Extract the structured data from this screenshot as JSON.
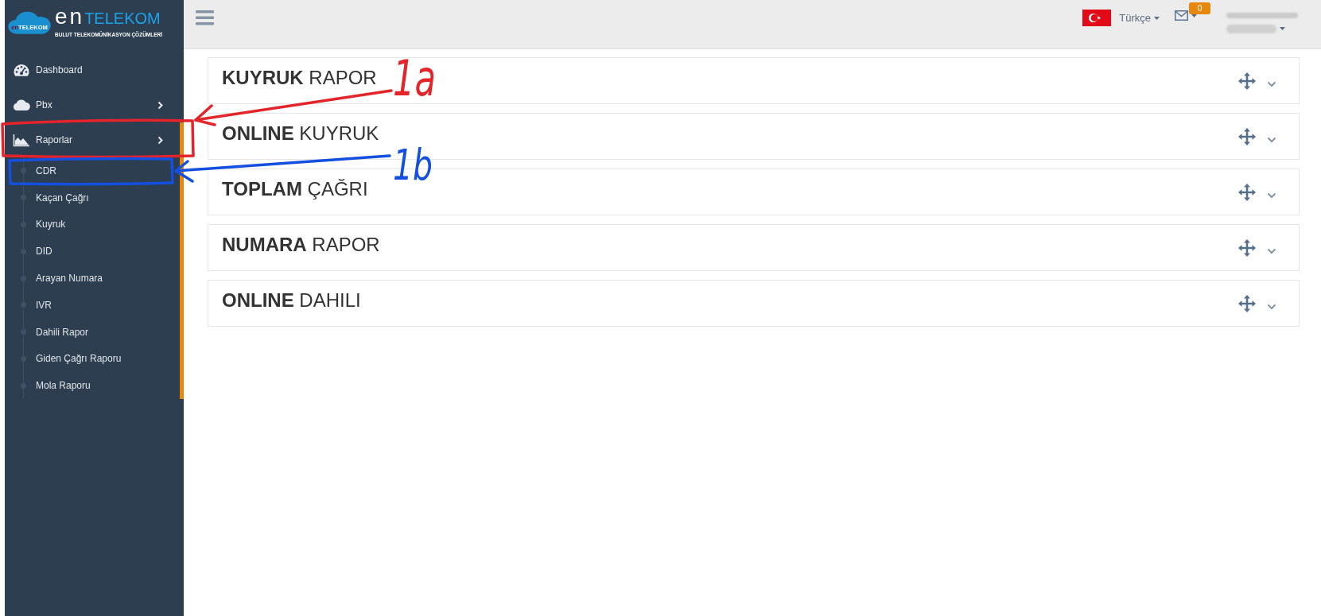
{
  "logo": {
    "badge": [
      "en",
      "TELEKOM"
    ],
    "wordmark": [
      "en",
      "TELEKOM"
    ],
    "tagline": "BULUT TELEKOMÜNİKASYON ÇÖZÜMLERİ"
  },
  "sidebar": {
    "items": [
      {
        "label": "Dashboard",
        "kind": "link"
      },
      {
        "label": "Pbx",
        "kind": "group",
        "expanded": false
      },
      {
        "label": "Raporlar",
        "kind": "group",
        "expanded": true,
        "children": [
          {
            "label": "CDR"
          },
          {
            "label": "Kaçan Çağrı"
          },
          {
            "label": "Kuyruk"
          },
          {
            "label": "DID"
          },
          {
            "label": "Arayan Numara"
          },
          {
            "label": "IVR"
          },
          {
            "label": "Dahili Rapor"
          },
          {
            "label": "Giden Çağrı Raporu"
          },
          {
            "label": "Mola Raporu"
          }
        ]
      }
    ]
  },
  "topbar": {
    "language": "Türkçe",
    "message_count": "0"
  },
  "panels": [
    {
      "title": "**KUYRUK** RAPOR"
    },
    {
      "title": "**ONLINE** KUYRUK"
    },
    {
      "title": "**TOPLAM** ÇAĞRI"
    },
    {
      "title": "**NUMARA** RAPOR"
    },
    {
      "title": "**ONLINE** DAHILI"
    }
  ],
  "annotations": [
    {
      "label": "1a",
      "color": "#e3242b"
    },
    {
      "label": "1b",
      "color": "#1450e0"
    }
  ]
}
